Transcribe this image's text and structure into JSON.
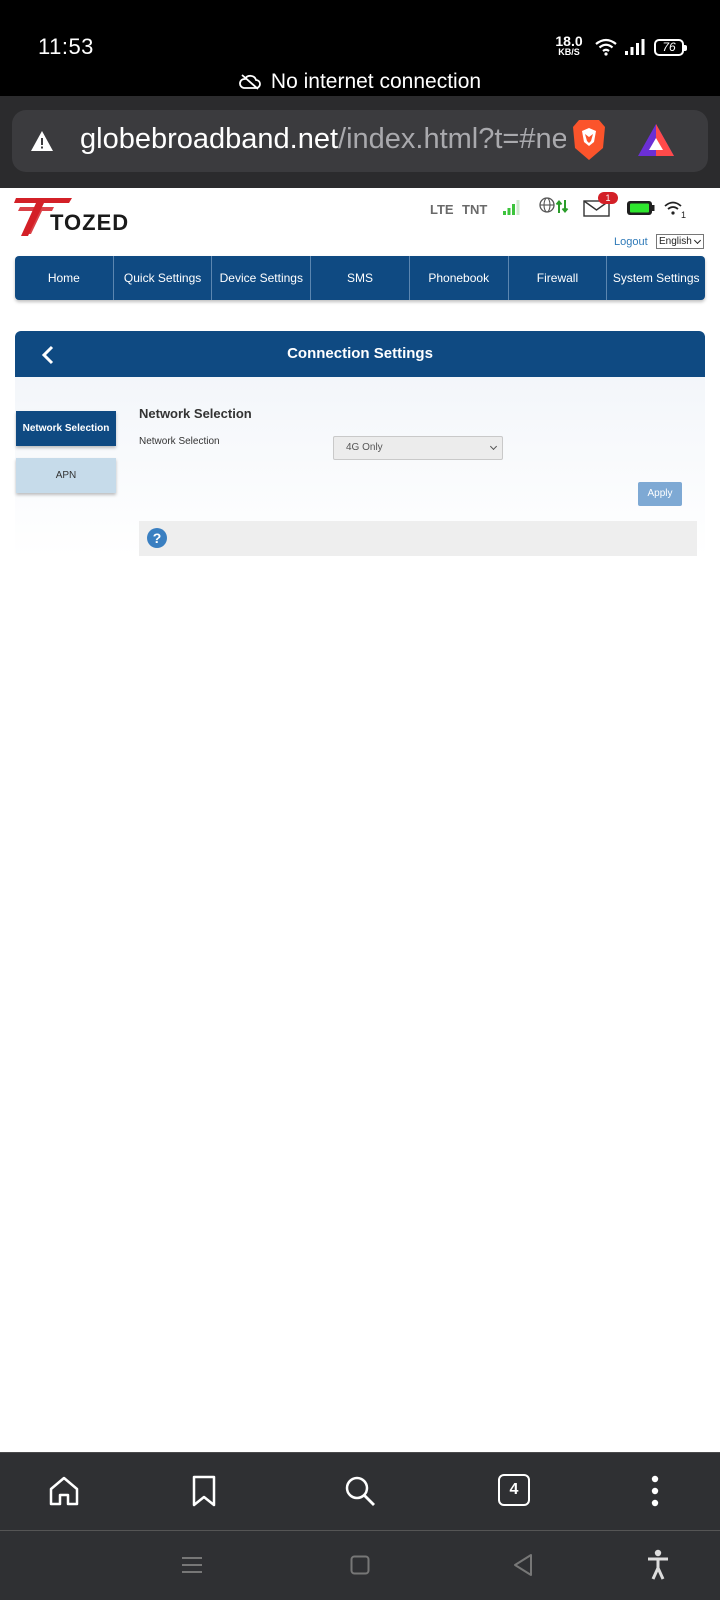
{
  "status_bar": {
    "time": "11:53",
    "net_speed_value": "18.0",
    "net_speed_unit": "KB/S",
    "battery": "76",
    "connection_notice": "No internet connection"
  },
  "browser": {
    "url_host": "globebroadband.net",
    "url_rest": "/index.html?t=#ne",
    "tab_count": "4"
  },
  "router": {
    "brand": "TOZED",
    "network_type": "LTE",
    "carrier": "TNT",
    "sms_badge": "1",
    "wifi_clients": "1",
    "logout_label": "Logout",
    "language": "English",
    "nav": [
      "Home",
      "Quick Settings",
      "Device Settings",
      "SMS",
      "Phonebook",
      "Firewall",
      "System Settings"
    ],
    "section_title": "Connection Settings",
    "side_menu": [
      "Network Selection",
      "APN"
    ],
    "form": {
      "heading": "Network Selection",
      "field_label": "Network Selection",
      "selected_value": "4G Only",
      "apply_label": "Apply"
    },
    "help_icon": "?"
  },
  "colors": {
    "primary_blue": "#0f4a82",
    "light_blue": "#c6dbea",
    "apply_blue": "#7ea9d4",
    "brand_red": "#d32027",
    "signal_green": "#3cc43c"
  }
}
